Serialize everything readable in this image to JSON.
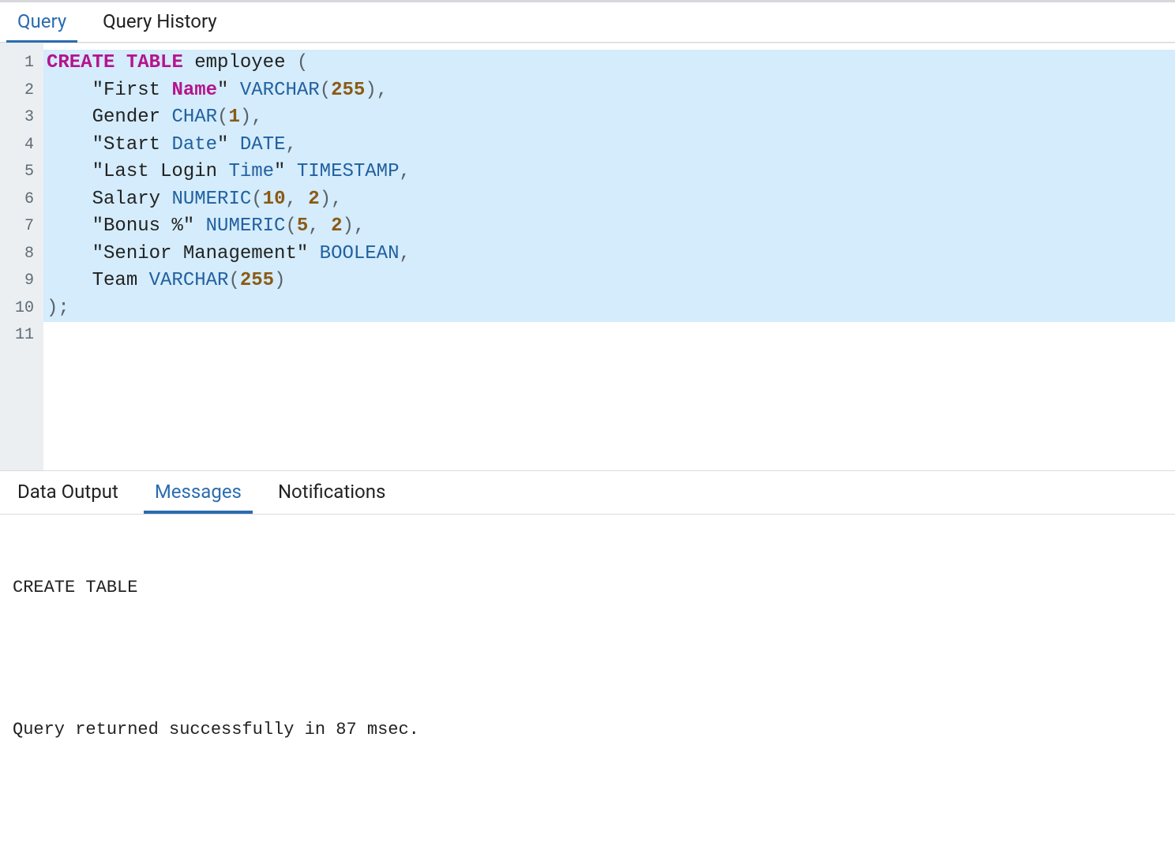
{
  "top_tabs": {
    "query": "Query",
    "history": "Query History",
    "active": "query"
  },
  "editor": {
    "line_count": 11,
    "highlight_start": 1,
    "highlight_end": 10,
    "lines": [
      [
        {
          "c": "tok-kw",
          "t": "CREATE"
        },
        {
          "c": "",
          "t": " "
        },
        {
          "c": "tok-kw",
          "t": "TABLE"
        },
        {
          "c": "",
          "t": " "
        },
        {
          "c": "tok-ident",
          "t": "employee"
        },
        {
          "c": "",
          "t": " "
        },
        {
          "c": "tok-punct",
          "t": "("
        }
      ],
      [
        {
          "c": "",
          "t": "    "
        },
        {
          "c": "tok-str",
          "t": "\"First "
        },
        {
          "c": "tok-strkw",
          "t": "Name"
        },
        {
          "c": "tok-str",
          "t": "\""
        },
        {
          "c": "",
          "t": " "
        },
        {
          "c": "tok-type",
          "t": "VARCHAR"
        },
        {
          "c": "tok-punct",
          "t": "("
        },
        {
          "c": "tok-num",
          "t": "255"
        },
        {
          "c": "tok-punct",
          "t": "),"
        }
      ],
      [
        {
          "c": "",
          "t": "    "
        },
        {
          "c": "tok-ident",
          "t": "Gender"
        },
        {
          "c": "",
          "t": " "
        },
        {
          "c": "tok-type",
          "t": "CHAR"
        },
        {
          "c": "tok-punct",
          "t": "("
        },
        {
          "c": "tok-num",
          "t": "1"
        },
        {
          "c": "tok-punct",
          "t": "),"
        }
      ],
      [
        {
          "c": "",
          "t": "    "
        },
        {
          "c": "tok-str",
          "t": "\"Start "
        },
        {
          "c": "tok-strty",
          "t": "Date"
        },
        {
          "c": "tok-str",
          "t": "\""
        },
        {
          "c": "",
          "t": " "
        },
        {
          "c": "tok-type",
          "t": "DATE"
        },
        {
          "c": "tok-punct",
          "t": ","
        }
      ],
      [
        {
          "c": "",
          "t": "    "
        },
        {
          "c": "tok-str",
          "t": "\"Last Login "
        },
        {
          "c": "tok-strty",
          "t": "Time"
        },
        {
          "c": "tok-str",
          "t": "\""
        },
        {
          "c": "",
          "t": " "
        },
        {
          "c": "tok-type",
          "t": "TIMESTAMP"
        },
        {
          "c": "tok-punct",
          "t": ","
        }
      ],
      [
        {
          "c": "",
          "t": "    "
        },
        {
          "c": "tok-ident",
          "t": "Salary"
        },
        {
          "c": "",
          "t": " "
        },
        {
          "c": "tok-type",
          "t": "NUMERIC"
        },
        {
          "c": "tok-punct",
          "t": "("
        },
        {
          "c": "tok-num",
          "t": "10"
        },
        {
          "c": "tok-punct",
          "t": ", "
        },
        {
          "c": "tok-num",
          "t": "2"
        },
        {
          "c": "tok-punct",
          "t": "),"
        }
      ],
      [
        {
          "c": "",
          "t": "    "
        },
        {
          "c": "tok-str",
          "t": "\"Bonus %\""
        },
        {
          "c": "",
          "t": " "
        },
        {
          "c": "tok-type",
          "t": "NUMERIC"
        },
        {
          "c": "tok-punct",
          "t": "("
        },
        {
          "c": "tok-num",
          "t": "5"
        },
        {
          "c": "tok-punct",
          "t": ", "
        },
        {
          "c": "tok-num",
          "t": "2"
        },
        {
          "c": "tok-punct",
          "t": "),"
        }
      ],
      [
        {
          "c": "",
          "t": "    "
        },
        {
          "c": "tok-str",
          "t": "\"Senior Management\""
        },
        {
          "c": "",
          "t": " "
        },
        {
          "c": "tok-type",
          "t": "BOOLEAN"
        },
        {
          "c": "tok-punct",
          "t": ","
        }
      ],
      [
        {
          "c": "",
          "t": "    "
        },
        {
          "c": "tok-ident",
          "t": "Team"
        },
        {
          "c": "",
          "t": " "
        },
        {
          "c": "tok-type",
          "t": "VARCHAR"
        },
        {
          "c": "tok-punct",
          "t": "("
        },
        {
          "c": "tok-num",
          "t": "255"
        },
        {
          "c": "tok-punct",
          "t": ")"
        }
      ],
      [
        {
          "c": "tok-punct",
          "t": ");"
        }
      ],
      []
    ]
  },
  "bottom_tabs": {
    "data_output": "Data Output",
    "messages": "Messages",
    "notifications": "Notifications",
    "active": "messages"
  },
  "messages_panel": {
    "line1": "CREATE TABLE",
    "line2": "Query returned successfully in 87 msec."
  }
}
